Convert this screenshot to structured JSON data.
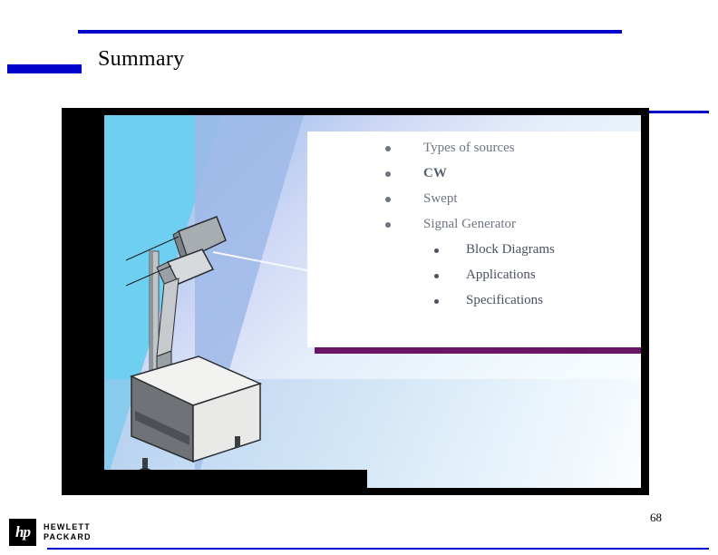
{
  "slide": {
    "title": "Summary",
    "page_number": "68"
  },
  "content": {
    "bullets": [
      {
        "label": "Types of sources",
        "level": 1,
        "bold": false
      },
      {
        "label": "CW",
        "level": 1,
        "bold": true
      },
      {
        "label": "Swept",
        "level": 1,
        "bold": false
      },
      {
        "label": "Signal Generator",
        "level": 1,
        "bold": false
      },
      {
        "label": "Block Diagrams",
        "level": 2,
        "bold": false
      },
      {
        "label": "Applications",
        "level": 2,
        "bold": false
      },
      {
        "label": "Specifications",
        "level": 2,
        "bold": false
      }
    ]
  },
  "footer": {
    "logo_mark": "hp",
    "brand_line1": "HEWLETT",
    "brand_line2": "PACKARD"
  },
  "colors": {
    "accent_blue": "#0000cc",
    "card_shadow_purple": "#6b1566",
    "frame_black": "#000000",
    "bullet_text": "#6e7582"
  }
}
